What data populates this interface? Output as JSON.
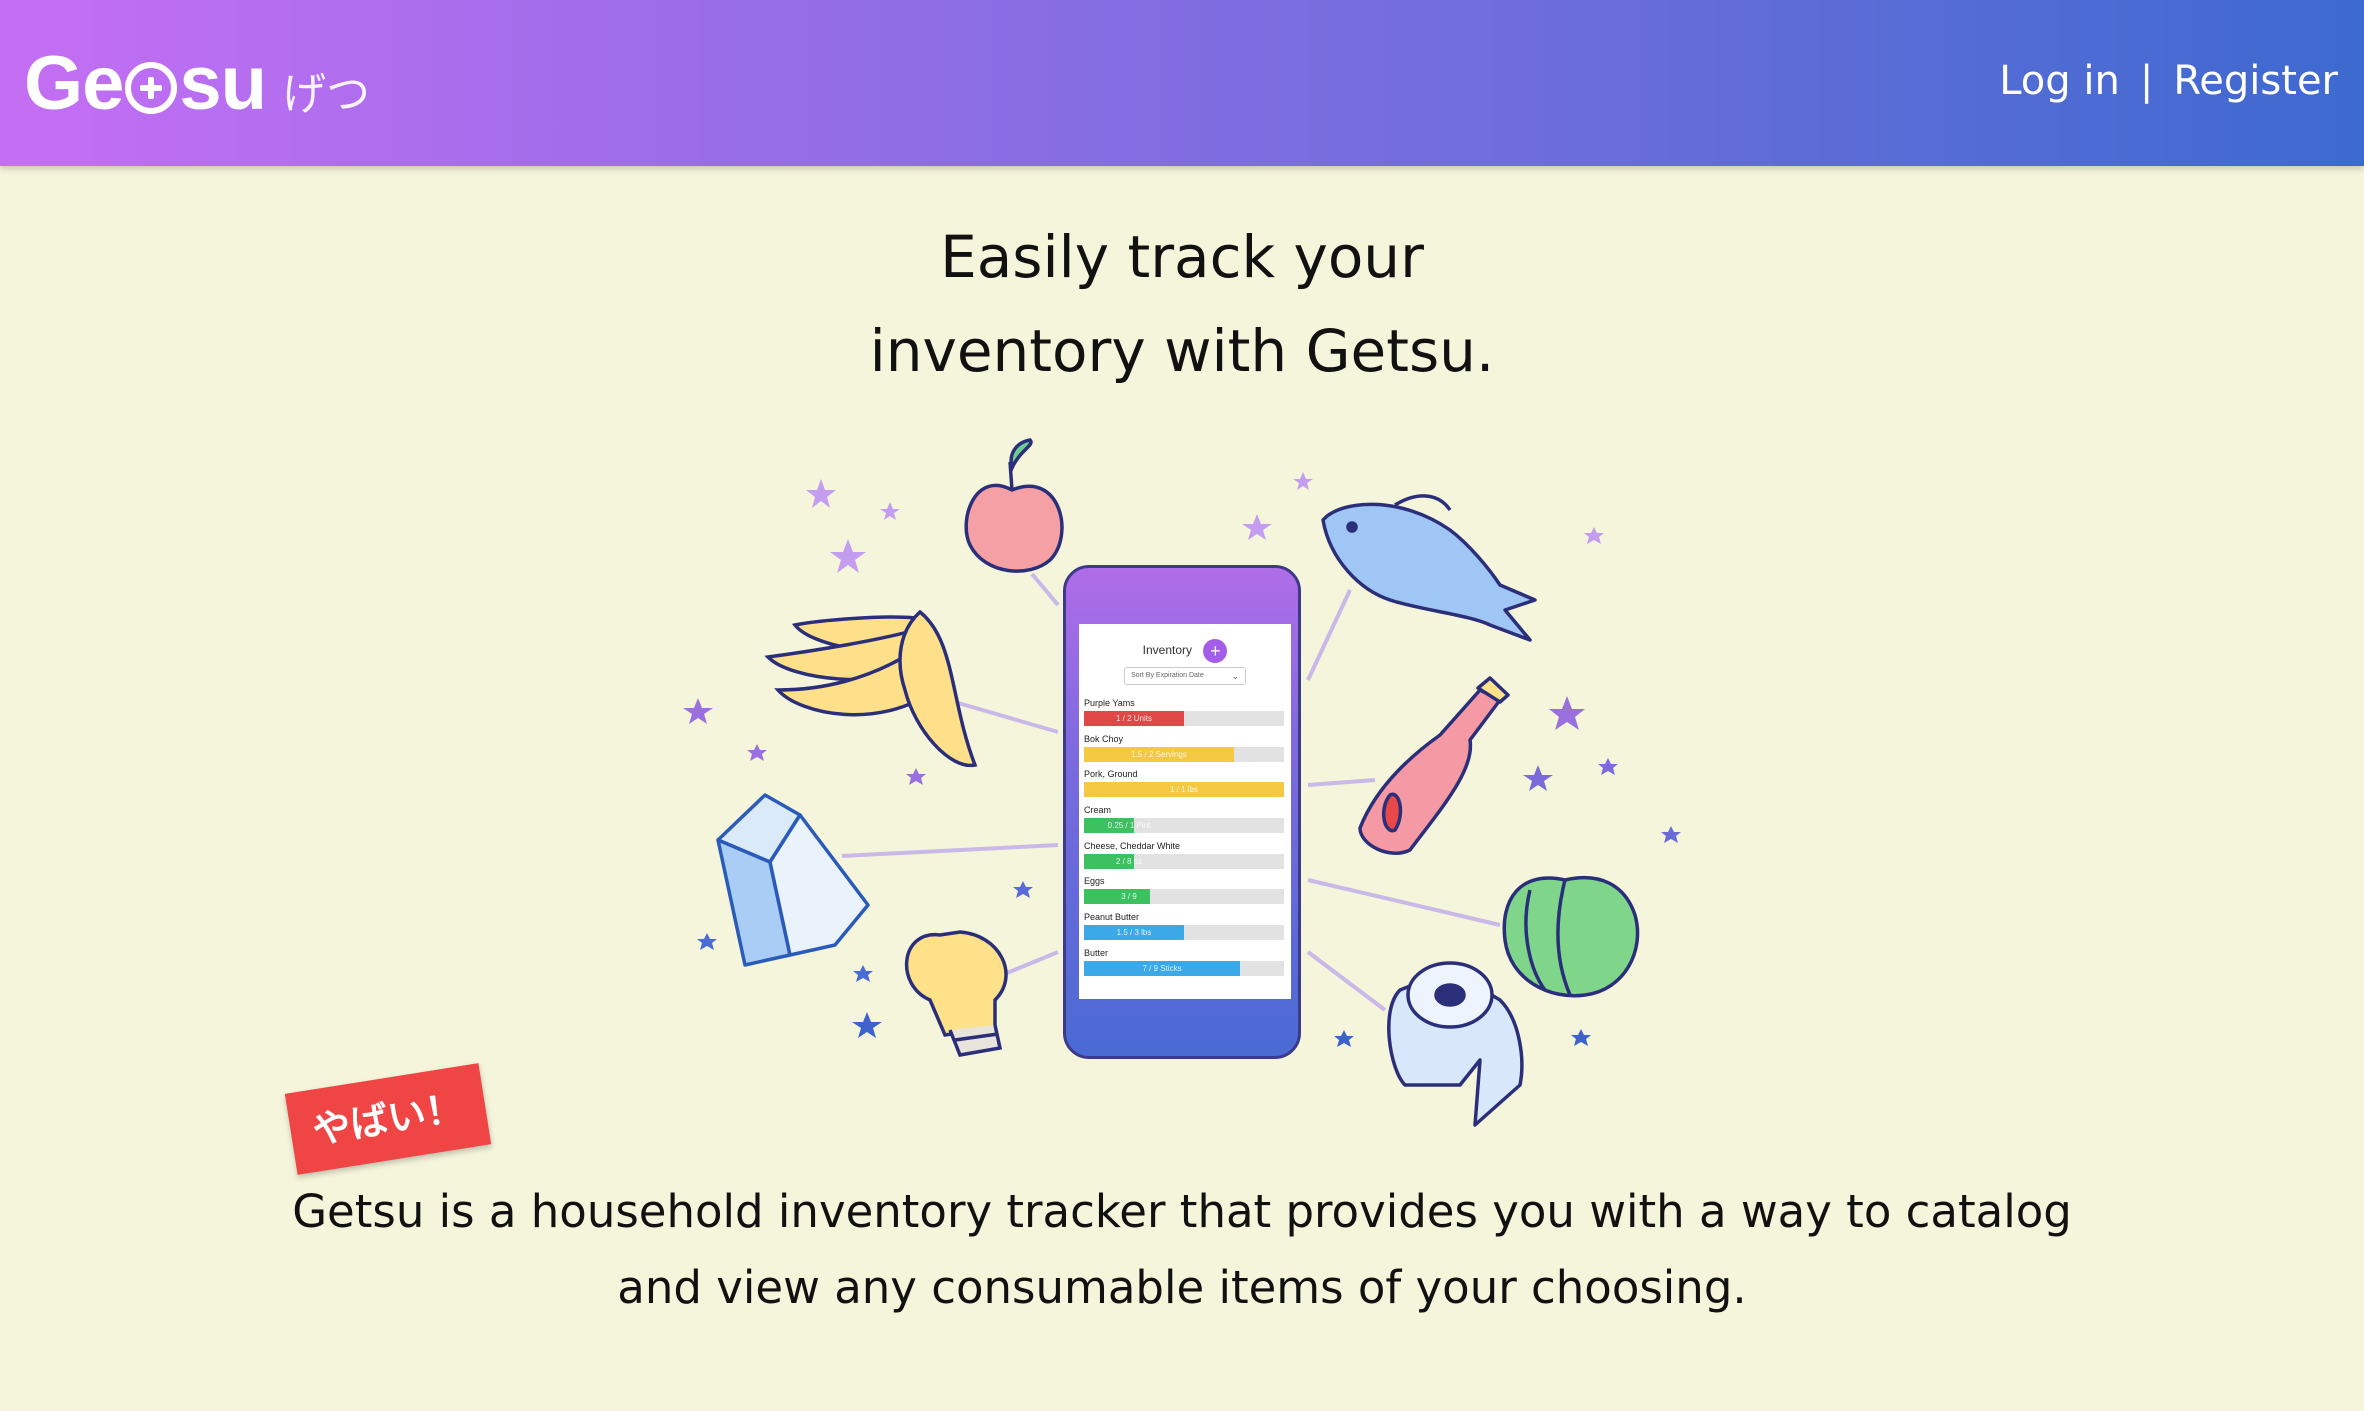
{
  "header": {
    "logo_text_left": "Ge",
    "logo_text_right": "su",
    "logo_kana": "げつ",
    "nav": {
      "login": "Log in",
      "separator": "|",
      "register": "Register"
    }
  },
  "hero": {
    "headline_line1": "Easily track your",
    "headline_line2": "inventory with Getsu."
  },
  "phone": {
    "title": "Inventory",
    "add_icon": "+",
    "sort_label": "Sort By   Expiration Date",
    "items": [
      {
        "name": "Purple Yams",
        "amount": "1 / 2 Units",
        "fill": 0.5,
        "color": "#e04848"
      },
      {
        "name": "Bok Choy",
        "amount": "1.5 / 2 Servings",
        "fill": 0.75,
        "color": "#f5c842"
      },
      {
        "name": "Pork, Ground",
        "amount": "1 / 1 lbs",
        "fill": 1.0,
        "color": "#f5c842"
      },
      {
        "name": "Cream",
        "amount": "0.25 / 1 Pint",
        "fill": 0.25,
        "color": "#3cc060"
      },
      {
        "name": "Cheese, Cheddar White",
        "amount": "2 / 8 oz",
        "fill": 0.25,
        "color": "#3cc060"
      },
      {
        "name": "Eggs",
        "amount": "3 / 9",
        "fill": 0.33,
        "color": "#3cc060"
      },
      {
        "name": "Peanut Butter",
        "amount": "1.5 / 3 lbs",
        "fill": 0.5,
        "color": "#3ba8e8"
      },
      {
        "name": "Butter",
        "amount": "7 / 9 Sticks",
        "fill": 0.78,
        "color": "#3ba8e8"
      }
    ]
  },
  "sticker": {
    "text": "やばい！"
  },
  "description": {
    "line1": "Getsu is a household inventory tracker that provides you with a way to catalog",
    "line2": "and view any consumable items of your choosing."
  },
  "colors": {
    "background": "#f5f5dc",
    "header_start": "#c56ef4",
    "header_end": "#3d6ad0",
    "sticker": "#f04545"
  }
}
